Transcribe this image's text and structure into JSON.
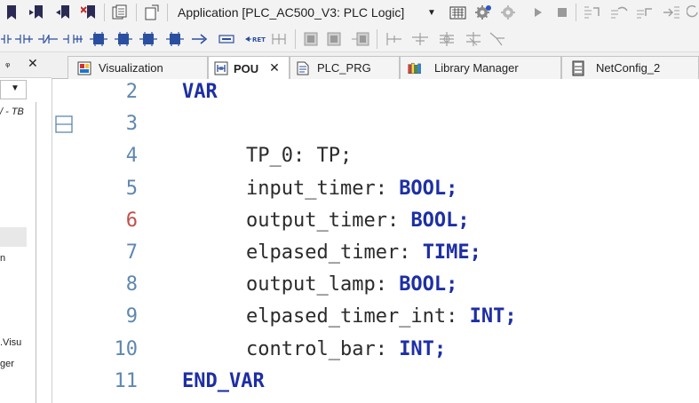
{
  "toolbar": {
    "application_selector": "Application [PLC_AC500_V3: PLC Logic]"
  },
  "toolbar_icons": [
    "bookmark-icon",
    "bookmark-next-icon",
    "bookmark-prev-icon",
    "bookmark-clear-icon",
    "copy-icon",
    "new-window-icon",
    "login-icon",
    "logout-icon",
    "run-icon",
    "stop-icon"
  ],
  "left_pane": {
    "pin_glyph": "ᵩ",
    "close_glyph": "✕",
    "dropdown_glyph": "▼",
    "fragments": [
      "/ - TB",
      "n",
      ".Visu",
      "ger"
    ]
  },
  "tabs": [
    {
      "label": "Visualization",
      "active": false,
      "icon": "visualization-icon"
    },
    {
      "label": "POU",
      "active": true,
      "icon": "pou-icon",
      "close": "✕"
    },
    {
      "label": "PLC_PRG",
      "active": false,
      "icon": "document-icon"
    },
    {
      "label": "Library Manager",
      "active": false,
      "icon": "library-icon"
    },
    {
      "label": "NetConfig_2",
      "active": false,
      "icon": "netconfig-icon"
    }
  ],
  "editor": {
    "lines": [
      {
        "number": "2",
        "indent": "",
        "name": "",
        "keyword": "VAR",
        "suffix": ""
      },
      {
        "number": "3",
        "indent": "",
        "name": "",
        "keyword": "",
        "suffix": "",
        "fold": true
      },
      {
        "number": "4",
        "indent": "    ",
        "name": "TP_0: TP;",
        "keyword": "",
        "suffix": ""
      },
      {
        "number": "5",
        "indent": "    ",
        "name": "input_timer: ",
        "keyword": "BOOL",
        "suffix": ";"
      },
      {
        "number": "6",
        "indent": "    ",
        "name": "output_timer: ",
        "keyword": "BOOL",
        "suffix": ";",
        "highlight": true
      },
      {
        "number": "7",
        "indent": "    ",
        "name": "elpased_timer: ",
        "keyword": "TIME",
        "suffix": ";"
      },
      {
        "number": "8",
        "indent": "    ",
        "name": "output_lamp: ",
        "keyword": "BOOL",
        "suffix": ";"
      },
      {
        "number": "9",
        "indent": "    ",
        "name": "elpased_timer_int: ",
        "keyword": "INT",
        "suffix": ";"
      },
      {
        "number": "10",
        "indent": "    ",
        "name": "control_bar: ",
        "keyword": "INT",
        "suffix": ";"
      },
      {
        "number": "11",
        "indent": "",
        "name": "",
        "keyword": "END_VAR",
        "suffix": ""
      }
    ]
  },
  "colors": {
    "keyword": "#1d2fa5",
    "line_number": "#5f87b0",
    "line_number_highlight": "#c0504d"
  }
}
